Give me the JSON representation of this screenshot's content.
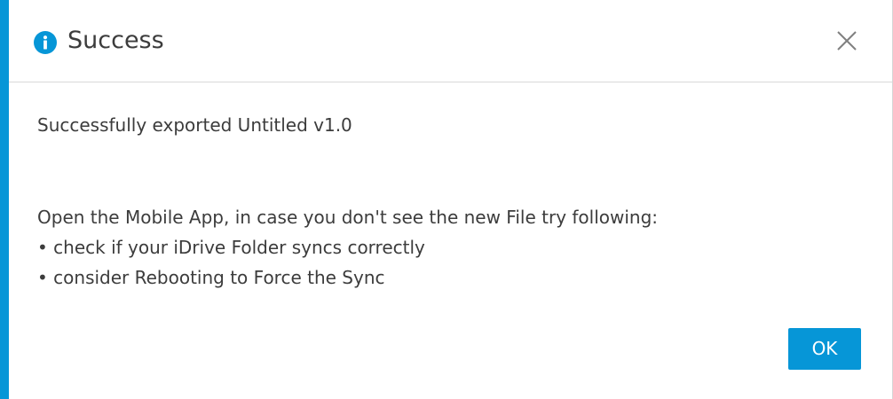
{
  "dialog": {
    "title": "Success",
    "title_icon": "info-icon",
    "close_icon": "close-icon",
    "accent_color": "#0696d7",
    "message": "Successfully exported Untitled v1.0",
    "instructions": "Open the Mobile App, in case you don't see the new File try following:",
    "bullets": [
      "• check if your iDrive Folder syncs correctly",
      "• consider Rebooting to Force the Sync"
    ],
    "ok_label": "OK"
  }
}
